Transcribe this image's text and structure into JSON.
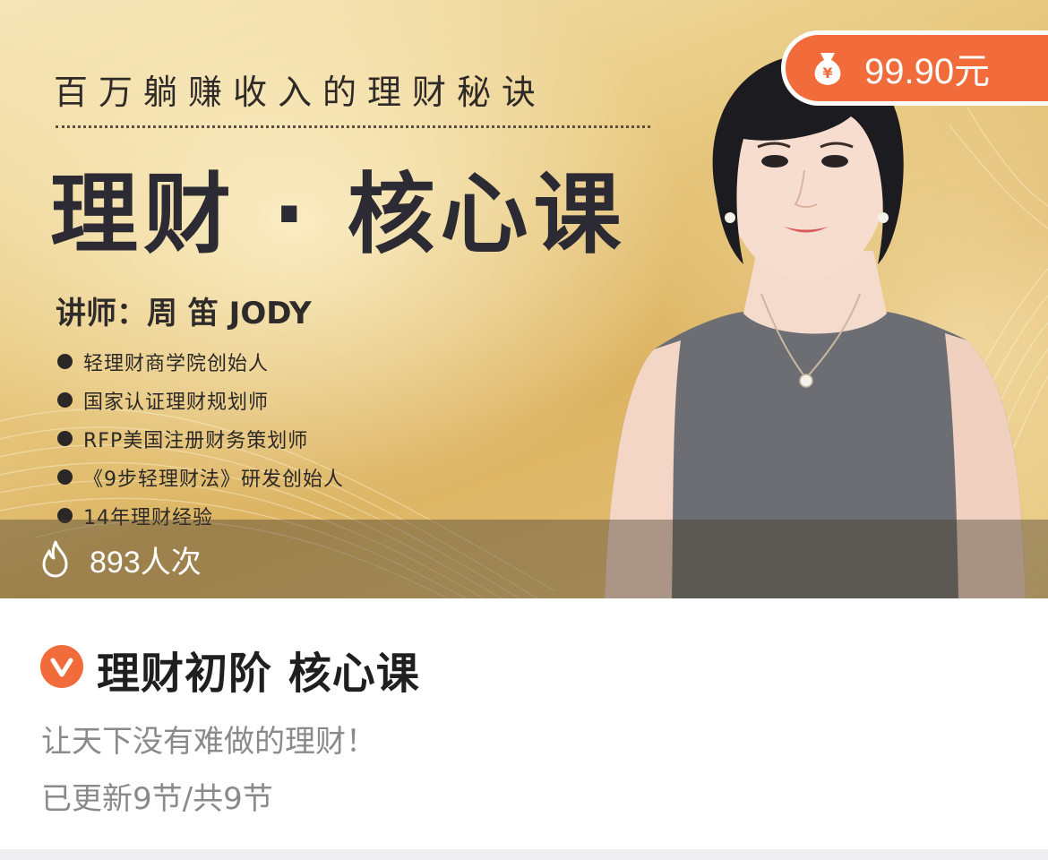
{
  "banner": {
    "subtitle": "百万躺赚收入的理财秘诀",
    "main_title": "理财 · 核心课",
    "teacher": "讲师：周 笛 JODY",
    "credentials": [
      "轻理财商学院创始人",
      "国家认证理财规划师",
      "RFP美国注册财务策划师",
      "《9步轻理财法》研发创始人",
      "14年理财经验"
    ]
  },
  "price": {
    "label": "99.90元",
    "icon": "money-bag-icon",
    "accent_color": "#f26b3a"
  },
  "stats": {
    "views": "893人次",
    "icon": "fire-icon"
  },
  "course": {
    "badge_icon": "verified-v-icon",
    "title": "理财初阶 核心课",
    "slogan": "让天下没有难做的理财！",
    "progress": "已更新9节/共9节"
  }
}
